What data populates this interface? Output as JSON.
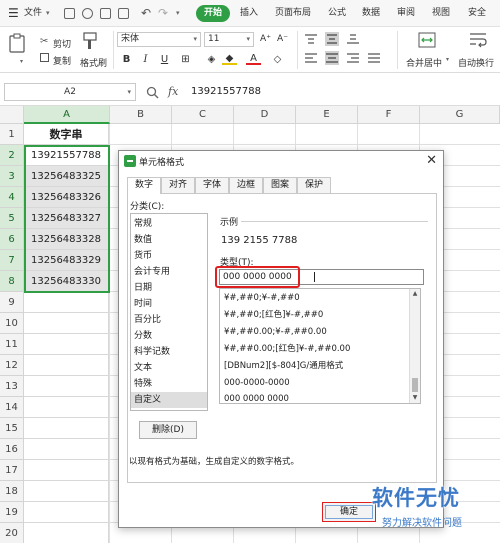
{
  "menubar": {
    "hamburger_label": "文件",
    "tabs": [
      "开始",
      "插入",
      "页面布局",
      "公式",
      "数据",
      "审阅",
      "视图",
      "安全"
    ]
  },
  "ribbon": {
    "cut": "剪切",
    "copy": "复制",
    "format_painter": "格式刷",
    "paste_icon": "paste-icon",
    "font_name": "宋体",
    "font_size": "11",
    "bold": "B",
    "italic": "I",
    "underline": "U",
    "font_color_letter": "A",
    "merge_center": "合并居中",
    "wrap_text": "自动换行"
  },
  "formula_bar": {
    "name_box": "A2",
    "fx": "fx",
    "value": "13921557788"
  },
  "sheet": {
    "columns": [
      "A",
      "B",
      "C",
      "D",
      "E",
      "F",
      "G"
    ],
    "rows": [
      "1",
      "2",
      "3",
      "4",
      "5",
      "6",
      "7",
      "8",
      "9",
      "10",
      "11",
      "12",
      "13",
      "14",
      "15",
      "16",
      "17",
      "18",
      "19",
      "20"
    ],
    "cells_a": [
      "数字串",
      "13921557788",
      "13256483325",
      "13256483326",
      "13256483327",
      "13256483328",
      "13256483329",
      "13256483330"
    ]
  },
  "dialog": {
    "title": "单元格格式",
    "tabs": [
      "数字",
      "对齐",
      "字体",
      "边框",
      "图案",
      "保护"
    ],
    "category_label": "分类(C):",
    "categories": [
      "常规",
      "数值",
      "货币",
      "会计专用",
      "日期",
      "时间",
      "百分比",
      "分数",
      "科学记数",
      "文本",
      "特殊",
      "自定义"
    ],
    "selected_category": "自定义",
    "sample_label": "示例",
    "sample_value": "139 2155 7788",
    "type_label": "类型(T):",
    "type_value": "000 0000 0000",
    "formats": [
      "¥#,##0;¥-#,##0",
      "¥#,##0;[红色]¥-#,##0",
      "¥#,##0.00;¥-#,##0.00",
      "¥#,##0.00;[红色]¥-#,##0.00",
      "[DBNum2][$-804]G/通用格式",
      "000-0000-0000",
      "000 0000 0000"
    ],
    "delete_button": "删除(D)",
    "description": "以现有格式为基础，生成自定义的数字格式。",
    "ok_button": "确定"
  },
  "watermark": {
    "brand": "软件无忧",
    "tagline": "努力解决软件问题"
  },
  "colors": {
    "accent": "#2f9e44",
    "highlight_red": "#e02020",
    "watermark_blue": "#3c7ac8"
  }
}
